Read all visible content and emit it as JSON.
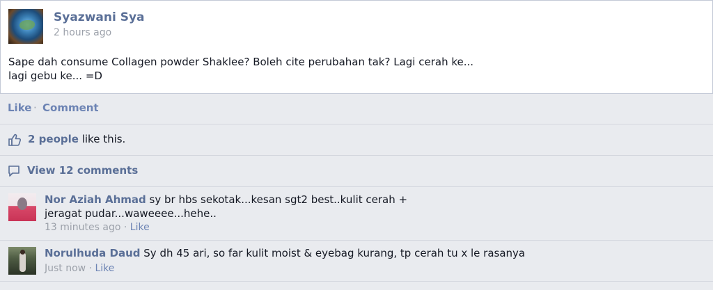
{
  "post": {
    "author": "Syazwani Sya",
    "time": "2 hours ago",
    "text": "Sape dah consume Collagen powder Shaklee? Boleh cite perubahan tak? Lagi cerah ke... lagi gebu ke... =D"
  },
  "actions": {
    "like": "Like",
    "separator": "·",
    "comment": "Comment"
  },
  "likes": {
    "count_text": "2 people",
    "suffix": " like this."
  },
  "view_comments": "View 12 comments",
  "comments": [
    {
      "author": "Nor Aziah Ahmad",
      "text": " sy br hbs sekotak...kesan sgt2 best..kulit cerah + jeragat pudar...waweeee...hehe..",
      "time": "13 minutes ago",
      "separator": " · ",
      "like": "Like"
    },
    {
      "author": "Norulhuda Daud",
      "text": " Sy dh 45 ari, so far kulit moist & eyebag kurang, tp cerah tu x le rasanya",
      "time": "Just now",
      "separator": " · ",
      "like": "Like"
    }
  ],
  "icons": {
    "poster_avatar": "globe-avatar",
    "likes": "thumbs-up-icon",
    "comments": "comment-bubble-icon"
  },
  "colors": {
    "link": "#5a6f97",
    "action": "#6d84b4",
    "muted": "#9ca1aa",
    "background": "#e9ebef"
  }
}
